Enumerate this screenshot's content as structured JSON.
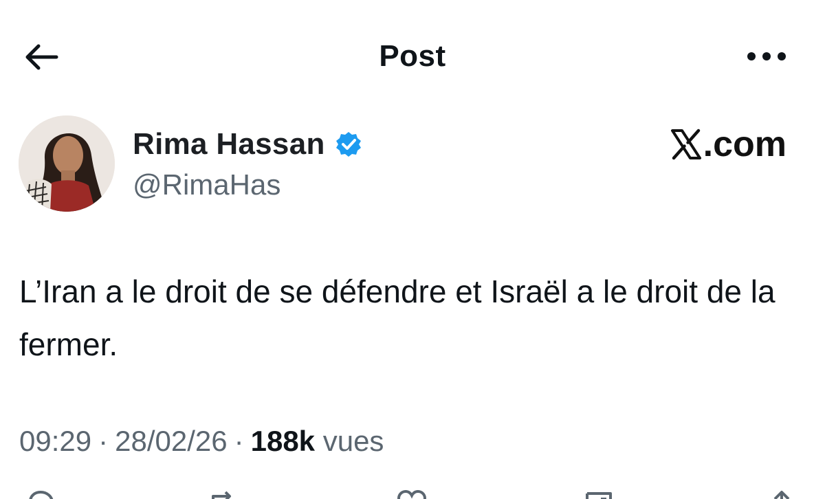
{
  "header": {
    "title": "Post",
    "back_icon": "arrow-left-icon",
    "more_icon": "more-horizontal-icon"
  },
  "author": {
    "display_name": "Rima Hassan",
    "handle": "@RimaHas",
    "verified": true,
    "verified_color": "#1d9bf0"
  },
  "watermark": {
    "text": ".com",
    "logo_icon": "x-logo-icon"
  },
  "post": {
    "text": "L’Iran a le droit de se défendre et Israël a le droit de la fermer."
  },
  "meta": {
    "time": "09:29",
    "date": "28/02/26",
    "views_count": "188k",
    "views_label": "vues",
    "separator": "·"
  },
  "actions": {
    "icons": [
      "reply-icon",
      "repost-icon",
      "like-icon",
      "bookmark-icon",
      "share-icon"
    ]
  },
  "colors": {
    "text_primary": "#0f1419",
    "text_secondary": "#5b6670",
    "background": "#ffffff"
  }
}
